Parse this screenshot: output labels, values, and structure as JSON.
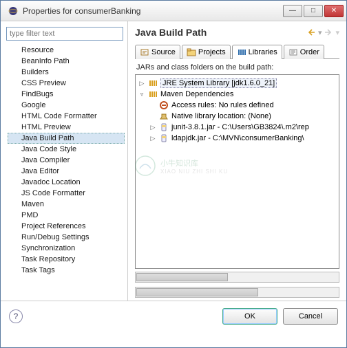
{
  "window": {
    "title": "Properties for consumerBanking"
  },
  "filter": {
    "placeholder": "type filter text"
  },
  "nav": {
    "items": [
      "Resource",
      "BeanInfo Path",
      "Builders",
      "CSS Preview",
      "FindBugs",
      "Google",
      "HTML Code Formatter",
      "HTML Preview",
      "Java Build Path",
      "Java Code Style",
      "Java Compiler",
      "Java Editor",
      "Javadoc Location",
      "JS Code Formatter",
      "Maven",
      "PMD",
      "Project References",
      "Run/Debug Settings",
      "Synchronization",
      "Task Repository",
      "Task Tags"
    ],
    "selected": "Java Build Path"
  },
  "page": {
    "title": "Java Build Path",
    "tabs": [
      "Source",
      "Projects",
      "Libraries",
      "Order"
    ],
    "activeTab": "Libraries",
    "panelLabel": "JARs and class folders on the build path:",
    "tree": [
      {
        "indent": 1,
        "twisty": "▷",
        "icon": "library-icon",
        "text": "JRE System Library [jdk1.6.0_21]",
        "selected": true
      },
      {
        "indent": 1,
        "twisty": "▿",
        "icon": "library-icon",
        "text": "Maven Dependencies"
      },
      {
        "indent": 2,
        "twisty": "",
        "icon": "rule-icon",
        "text": "Access rules: No rules defined"
      },
      {
        "indent": 2,
        "twisty": "",
        "icon": "native-icon",
        "text": "Native library location: (None)"
      },
      {
        "indent": 2,
        "twisty": "▷",
        "icon": "jar-icon",
        "text": "junit-3.8.1.jar - C:\\Users\\GB3824\\.m2\\rep"
      },
      {
        "indent": 2,
        "twisty": "▷",
        "icon": "jar-icon",
        "text": "ldapjdk.jar - C:\\MVN\\consumerBanking\\"
      }
    ]
  },
  "buttons": {
    "ok": "OK",
    "cancel": "Cancel"
  },
  "watermark": {
    "main": "小牛知识库",
    "sub": "XIAO NIU ZHI SHI KU"
  }
}
